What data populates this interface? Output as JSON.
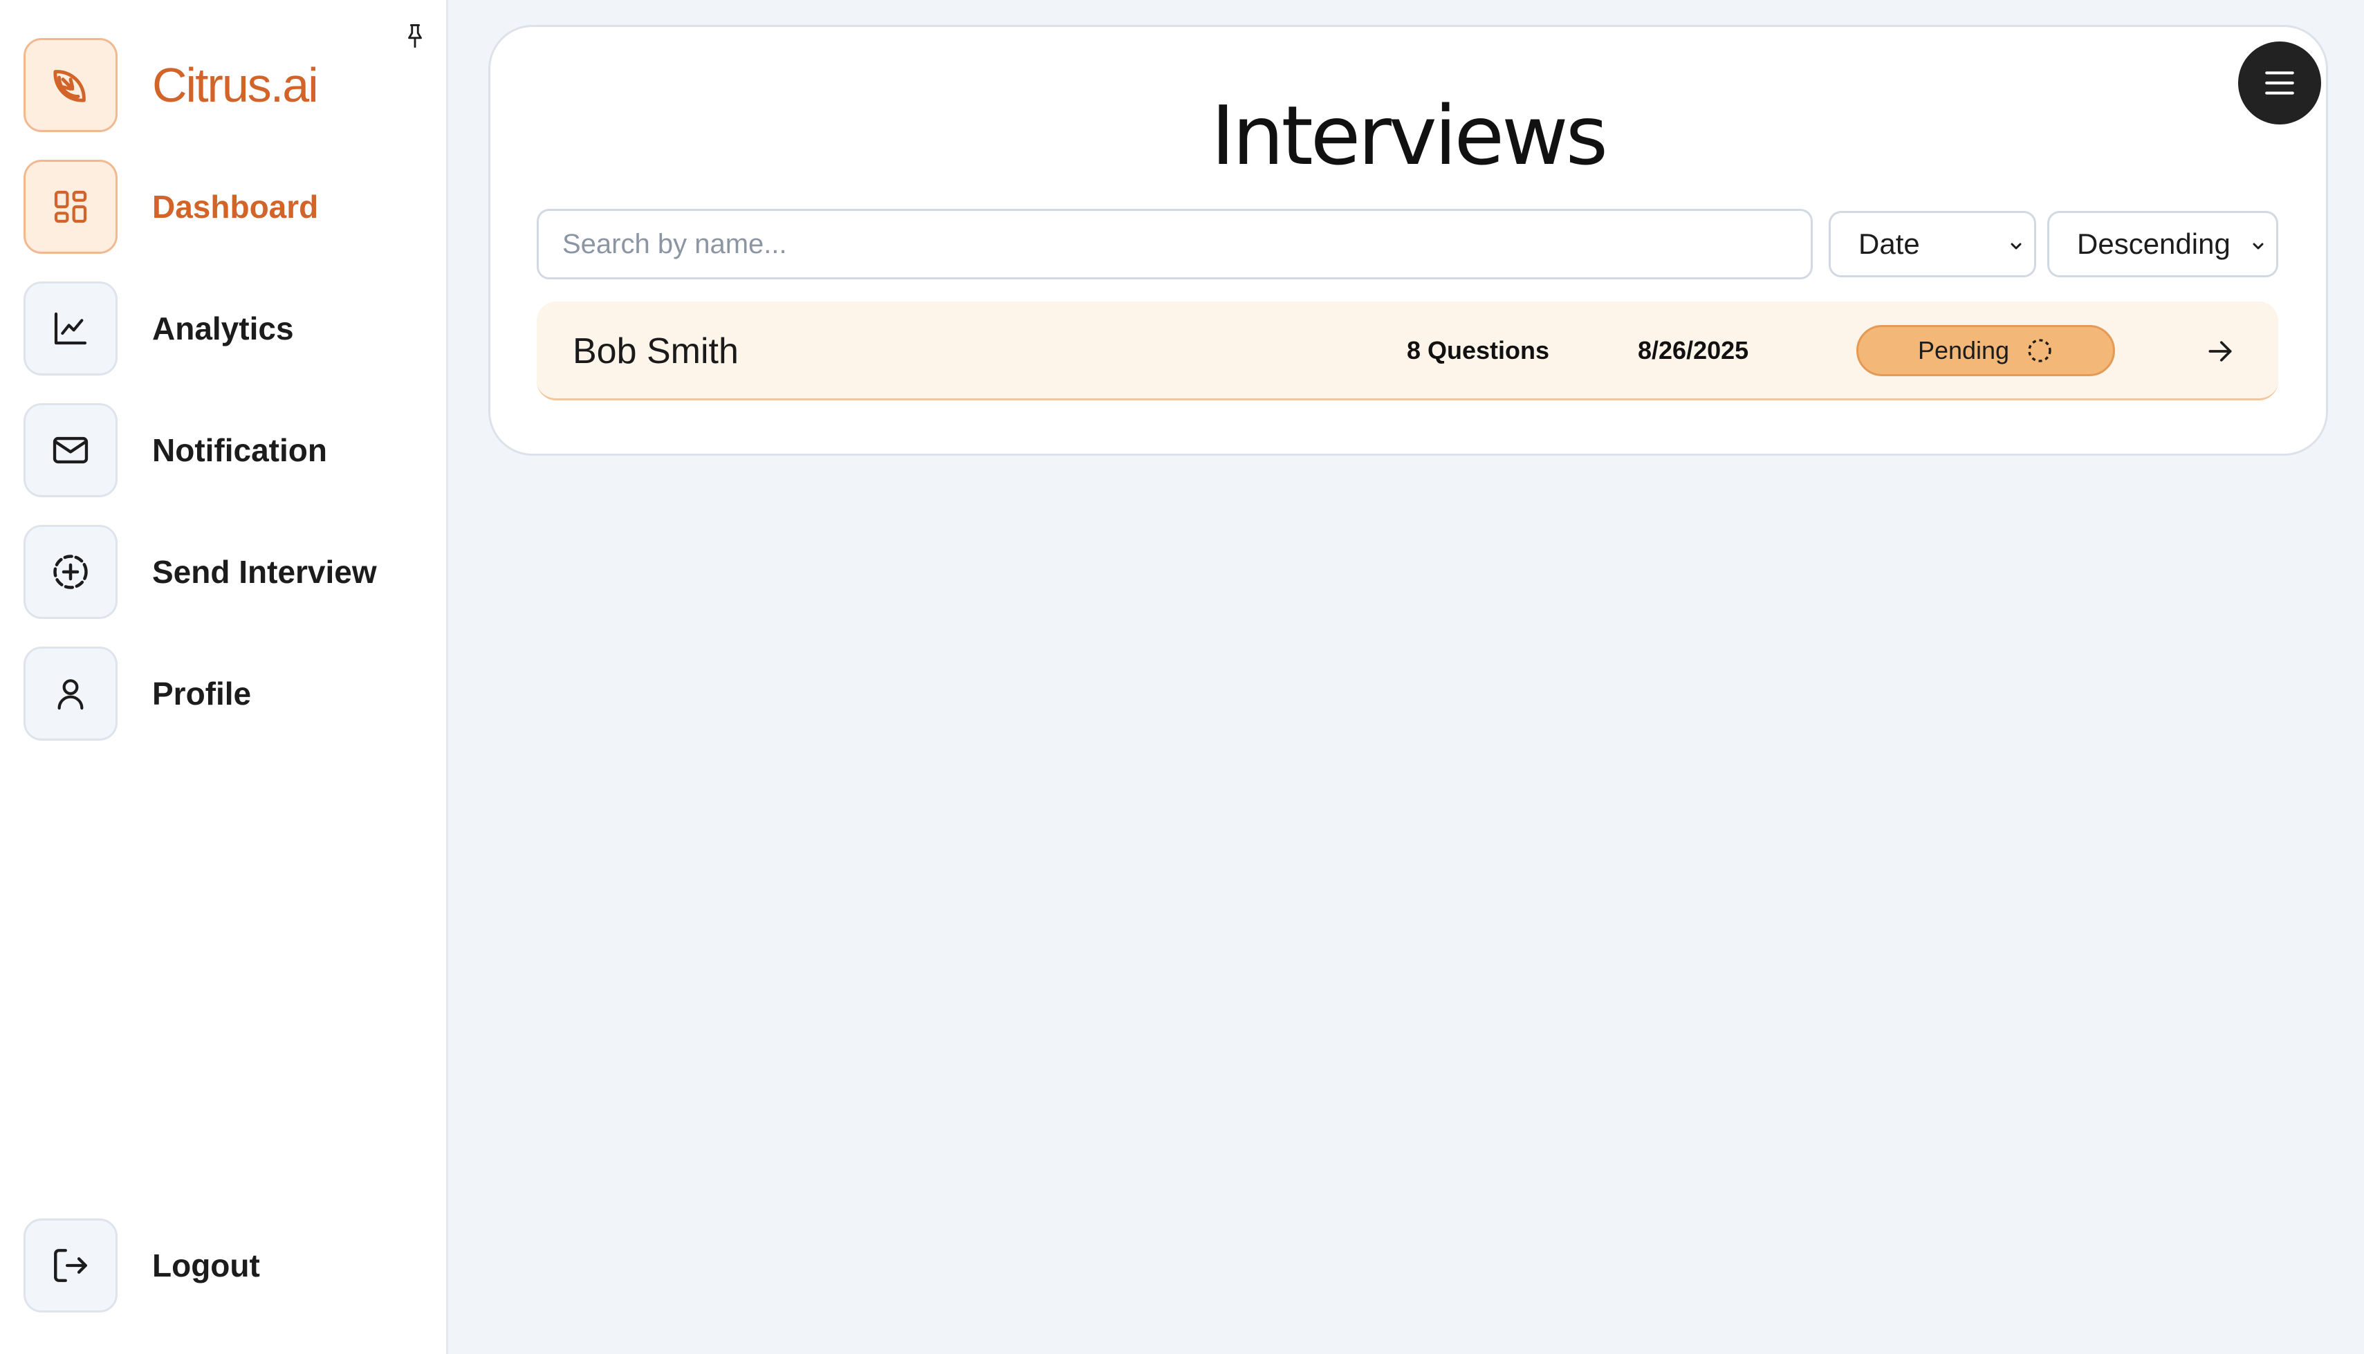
{
  "brand": {
    "name": "Citrus.ai",
    "logo_icon": "citrus-slice-icon"
  },
  "sidebar": {
    "pin_icon": "pin-icon",
    "items": [
      {
        "label": "Dashboard",
        "icon": "dashboard-grid-icon",
        "active": true
      },
      {
        "label": "Analytics",
        "icon": "line-chart-icon"
      },
      {
        "label": "Notification",
        "icon": "mail-icon"
      },
      {
        "label": "Send Interview",
        "icon": "plus-circle-dashed-icon"
      },
      {
        "label": "Profile",
        "icon": "user-icon"
      }
    ],
    "logout": {
      "label": "Logout",
      "icon": "logout-icon"
    }
  },
  "main": {
    "title": "Interviews",
    "menu_icon": "hamburger-menu-icon",
    "search": {
      "placeholder": "Search by name...",
      "value": ""
    },
    "sort_field": {
      "selected": "Date"
    },
    "sort_order": {
      "selected": "Descending"
    },
    "rows": [
      {
        "name": "Bob Smith",
        "questions": "8 Questions",
        "date": "8/26/2025",
        "status": "Pending",
        "status_icon": "loader-dashed-circle-icon",
        "action_icon": "arrow-right-icon"
      }
    ]
  },
  "colors": {
    "accent": "#d2642a",
    "accent_bg": "#fdeedf",
    "badge_bg": "#f3b877",
    "row_bg": "#fef5ea",
    "page_bg": "#f1f4f9"
  }
}
